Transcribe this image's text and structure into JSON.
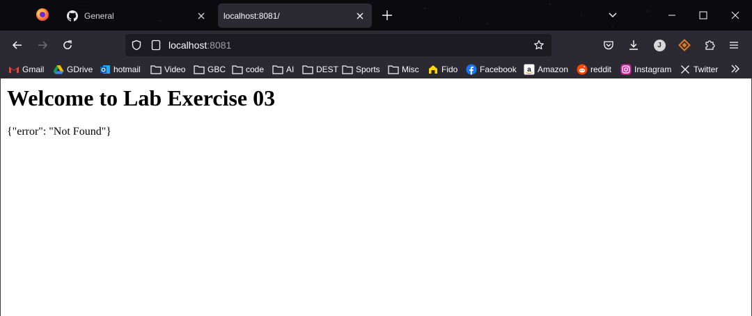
{
  "browser": {
    "tabs": [
      {
        "title": "General",
        "favicon": "github-icon",
        "active": false
      },
      {
        "title": "localhost:8081/",
        "favicon": "none",
        "active": true
      }
    ],
    "url": {
      "host": "localhost",
      "port": ":8081"
    },
    "account_initial": "J"
  },
  "bookmarks": [
    {
      "label": "Gmail",
      "icon": "gmail-icon"
    },
    {
      "label": "GDrive",
      "icon": "gdrive-icon"
    },
    {
      "label": "hotmail",
      "icon": "outlook-icon"
    },
    {
      "label": "Video",
      "icon": "folder-icon"
    },
    {
      "label": "GBC",
      "icon": "folder-icon"
    },
    {
      "label": "code",
      "icon": "folder-icon"
    },
    {
      "label": "AI",
      "icon": "folder-icon"
    },
    {
      "label": "DEST",
      "icon": "folder-icon"
    },
    {
      "label": "Sports",
      "icon": "folder-icon"
    },
    {
      "label": "Misc",
      "icon": "folder-icon"
    },
    {
      "label": "Fido",
      "icon": "fido-icon"
    },
    {
      "label": "Facebook",
      "icon": "facebook-icon"
    },
    {
      "label": "Amazon",
      "icon": "amazon-icon"
    },
    {
      "label": "reddit",
      "icon": "reddit-icon"
    },
    {
      "label": "Instagram",
      "icon": "instagram-icon"
    },
    {
      "label": "Twitter",
      "icon": "x-icon"
    }
  ],
  "page": {
    "heading": "Welcome to Lab Exercise 03",
    "body": "{\"error\": \"Not Found\"}"
  },
  "colors": {
    "tabstrip_bg": "#0b0b0f",
    "toolbar_bg": "#2b2a33",
    "urlbar_bg": "#1c1b22",
    "text": "#fbfbfe",
    "accent": "#e07b23"
  }
}
